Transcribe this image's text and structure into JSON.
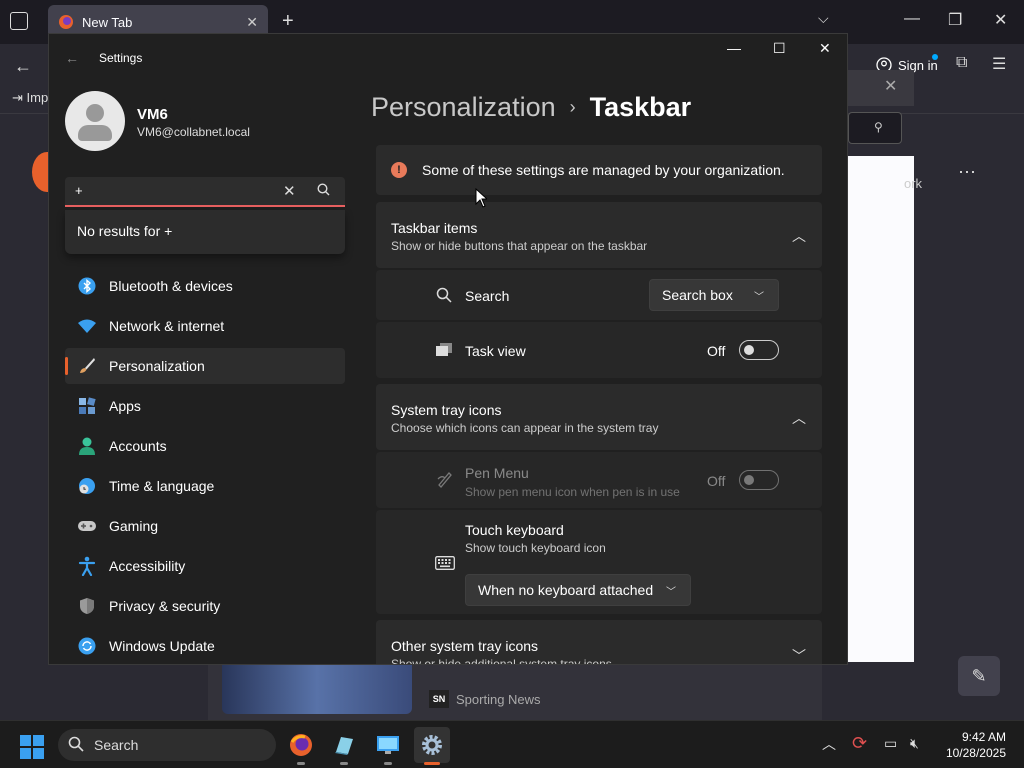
{
  "browser": {
    "tab_title": "New Tab",
    "tab_close": "✕",
    "new_tab": "+",
    "bookmark_import": "Imp",
    "sign_in": "Sign in",
    "side_text": "ork",
    "news_source": "Sporting News",
    "news_badge": "SN"
  },
  "settings": {
    "title": "Settings",
    "user": {
      "name": "VM6",
      "email": "VM6@collabnet.local"
    },
    "search": {
      "value": "+",
      "no_results": "No results for +"
    },
    "nav": [
      {
        "label": "Bluetooth & devices",
        "icon": "bluetooth-icon",
        "color": "#3aa0f0"
      },
      {
        "label": "Network & internet",
        "icon": "wifi-icon",
        "color": "#3aa0f0"
      },
      {
        "label": "Personalization",
        "icon": "paintbrush-icon",
        "color": "#e0a060",
        "active": true
      },
      {
        "label": "Apps",
        "icon": "apps-icon",
        "color": "#6aa8e0"
      },
      {
        "label": "Accounts",
        "icon": "person-icon",
        "color": "#3ac49a"
      },
      {
        "label": "Time & language",
        "icon": "globe-clock-icon",
        "color": "#3aa0f0"
      },
      {
        "label": "Gaming",
        "icon": "gamepad-icon",
        "color": "#b0b0b0"
      },
      {
        "label": "Accessibility",
        "icon": "accessibility-icon",
        "color": "#3aa0f0"
      },
      {
        "label": "Privacy & security",
        "icon": "shield-icon",
        "color": "#9a9a9a"
      },
      {
        "label": "Windows Update",
        "icon": "refresh-icon",
        "color": "#3aa0f0"
      }
    ],
    "breadcrumb": {
      "parent": "Personalization",
      "separator": "›",
      "current": "Taskbar"
    },
    "managed_notice": "Some of these settings are managed by your organization.",
    "taskbar_items": {
      "title": "Taskbar items",
      "subtitle": "Show or hide buttons that appear on the taskbar",
      "search_label": "Search",
      "search_value": "Search box",
      "taskview_label": "Task view",
      "taskview_state": "Off"
    },
    "system_tray": {
      "title": "System tray icons",
      "subtitle": "Choose which icons can appear in the system tray",
      "pen_label": "Pen Menu",
      "pen_sub": "Show pen menu icon when pen is in use",
      "pen_state": "Off",
      "touch_label": "Touch keyboard",
      "touch_sub": "Show touch keyboard icon",
      "touch_value": "When no keyboard attached"
    },
    "other_tray": {
      "title": "Other system tray icons",
      "subtitle": "Show or hide additional system tray icons"
    }
  },
  "taskbar": {
    "search_label": "Search",
    "time": "9:42 AM",
    "date": "10/28/2025"
  }
}
